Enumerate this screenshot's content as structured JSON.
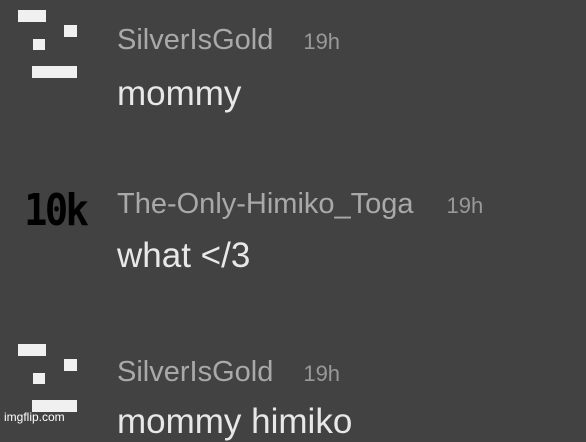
{
  "comments": [
    {
      "username": "SilverIsGold",
      "time": "19h",
      "text": "mommy",
      "avatar_icon": "pixel-blocks-avatar-icon"
    },
    {
      "username": "The-Only-Himiko_Toga",
      "time": "19h",
      "text": "what </3",
      "avatar_text": "10k"
    },
    {
      "username": "SilverIsGold",
      "time": "19h",
      "text": "mommy himiko",
      "avatar_icon": "pixel-blocks-avatar-icon"
    }
  ],
  "watermark": "imgflip.com",
  "colors": {
    "background": "#424242",
    "username": "#a9a9a9",
    "timestamp": "#999999",
    "body_text": "#e8e8e8",
    "avatar_pixels": "#f0f0f0"
  }
}
